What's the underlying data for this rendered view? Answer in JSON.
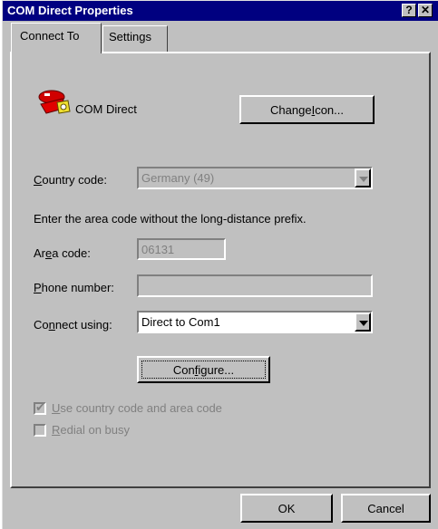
{
  "window": {
    "title": "COM Direct Properties",
    "help_btn": "?",
    "close_btn": "✕"
  },
  "tabs": [
    {
      "label": "Connect To",
      "active": true
    },
    {
      "label": "Settings",
      "active": false
    }
  ],
  "connection": {
    "name": "COM Direct",
    "change_icon_btn_pre": "Change ",
    "change_icon_btn_ul": "I",
    "change_icon_btn_post": "con..."
  },
  "country": {
    "label_ul": "C",
    "label_rest": "ountry code:",
    "value": "Germany (49)"
  },
  "instruction": "Enter the area code without the long-distance prefix.",
  "area": {
    "label_pre": "Ar",
    "label_ul": "e",
    "label_post": "a code:",
    "value": "06131"
  },
  "phone": {
    "label_ul": "P",
    "label_rest": "hone number:",
    "value": ""
  },
  "connect_using": {
    "label_pre": "Co",
    "label_ul": "n",
    "label_post": "nect using:",
    "value": "Direct to Com1"
  },
  "configure_btn": {
    "pre": "Con",
    "ul": "f",
    "post": "igure..."
  },
  "checkboxes": [
    {
      "pre": "",
      "ul": "U",
      "post": "se country code and area code",
      "checked": true,
      "enabled": false
    },
    {
      "pre": "",
      "ul": "R",
      "post": "edial on busy",
      "checked": false,
      "enabled": false
    }
  ],
  "footer": {
    "ok": "OK",
    "cancel": "Cancel"
  },
  "colors": {
    "titlebar": "#000080",
    "face": "#c0c0c0",
    "disabled_text": "#808080"
  }
}
